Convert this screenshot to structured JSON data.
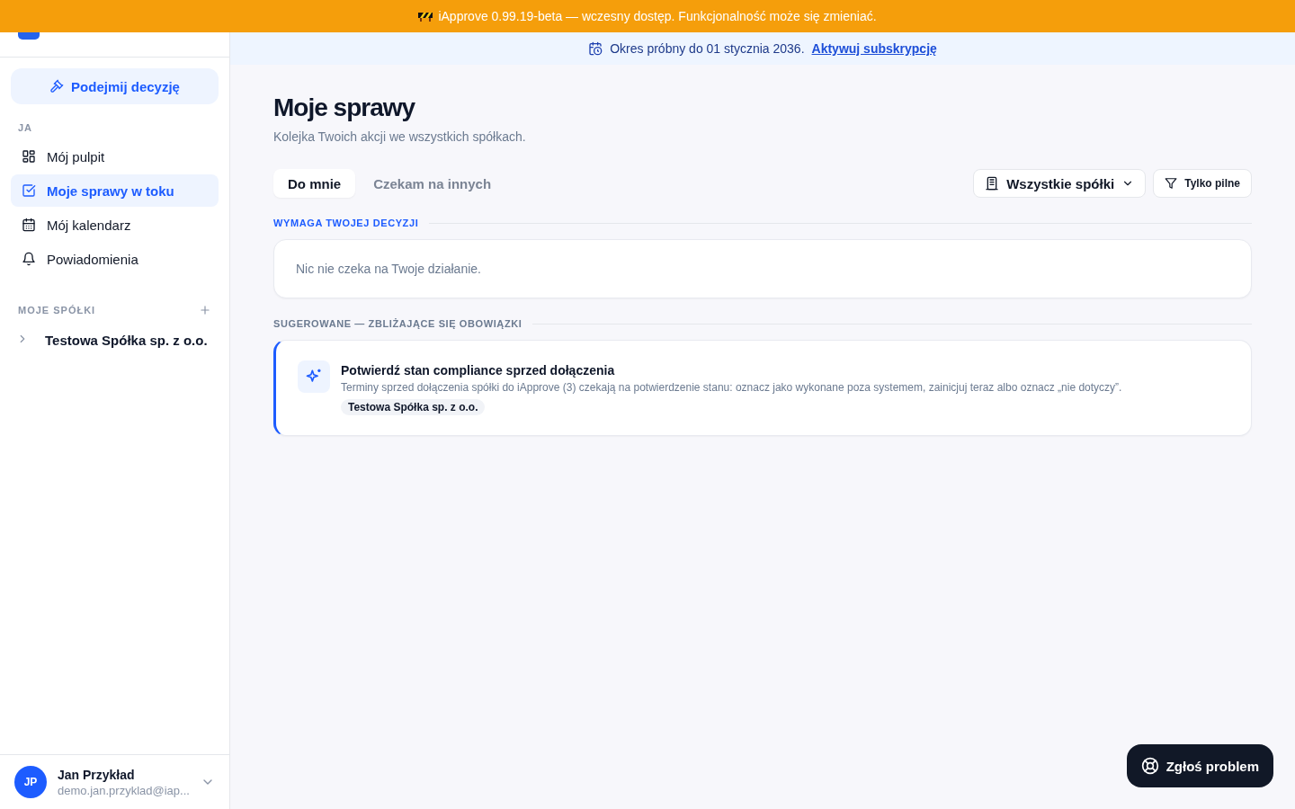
{
  "banner": {
    "text": "iApprove 0.99.19-beta — wczesny dostęp. Funkcjonalność może się zmieniać."
  },
  "sidebar": {
    "primary_button": "Podejmij decyzję",
    "section": {
      "title": "JA",
      "items": [
        {
          "label": "Mój pulpit",
          "kind": "dashboard",
          "selected": false
        },
        {
          "label": "Moje sprawy w toku",
          "kind": "tasks",
          "selected": true
        },
        {
          "label": "Mój kalendarz",
          "kind": "calendar",
          "selected": false
        },
        {
          "label": "Powiadomienia",
          "kind": "notifications",
          "selected": false
        }
      ]
    },
    "companies": {
      "title": "MOJE SPÓŁKI",
      "items": [
        {
          "label": "Testowa Spółka sp. z o.o.",
          "expanded": false
        }
      ]
    },
    "user": {
      "initials": "JP",
      "name": "Jan Przykład",
      "email": "demo.jan.przyklad@iap..."
    }
  },
  "trial_bar": {
    "text": "Okres próbny do 01 stycznia 2036.",
    "link": "Aktywuj subskrypcję"
  },
  "page": {
    "title": "Moje sprawy",
    "subtitle": "Kolejka Twoich akcji we wszystkich spółkach."
  },
  "tabs": [
    {
      "label": "Do mnie",
      "selected": true
    },
    {
      "label": "Czekam na innych",
      "selected": false
    }
  ],
  "filters": {
    "company": "Wszystkie spółki",
    "urgent": {
      "label": "Tylko pilne",
      "on": false
    }
  },
  "sections": [
    {
      "kind": "decision",
      "title": "WYMAGA TWOJEJ DECYZJI",
      "empty_text": "Nic nie czeka na Twoje działanie."
    },
    {
      "kind": "suggested",
      "title": "SUGEROWANE — ZBLIŻAJĄCE SIĘ OBOWIĄZKI",
      "cards": [
        {
          "title": "Potwierdź stan compliance sprzed dołączenia",
          "description": "Terminy sprzed dołączenia spółki do iApprove (3) czekają na potwierdzenie stanu: oznacz jako wykonane poza systemem, zainicjuj teraz albo oznacz „nie dotyczy”.",
          "tag": "Testowa Spółka sp. z o.o."
        }
      ]
    }
  ],
  "help_button": "Zgłoś problem"
}
